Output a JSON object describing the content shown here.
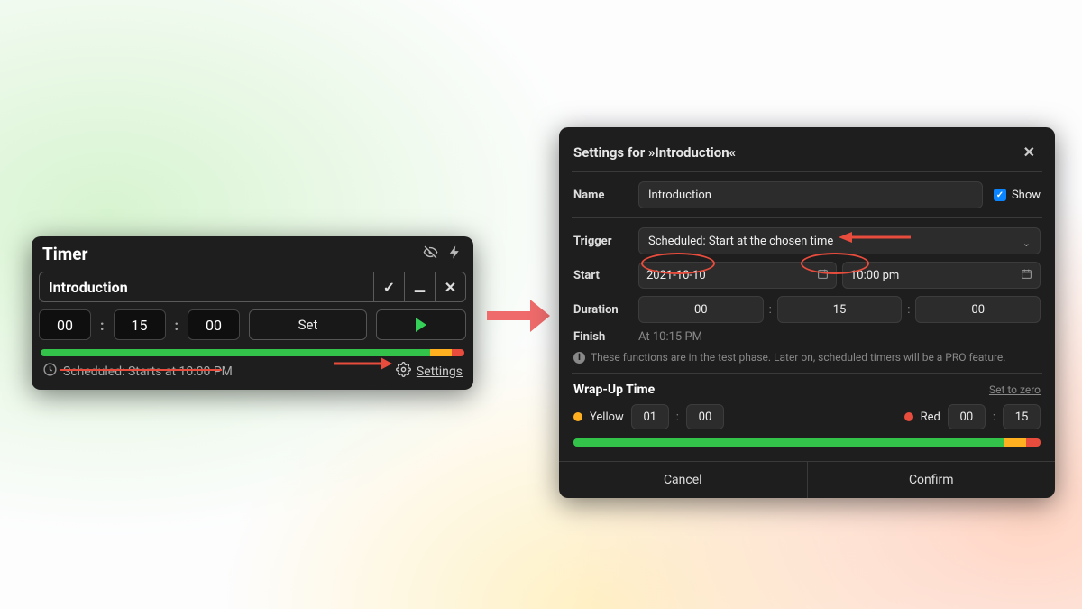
{
  "mini": {
    "title": "Timer",
    "item_label": "Introduction",
    "hh": "00",
    "mm": "15",
    "ss": "00",
    "set_label": "Set",
    "scheduled_text": "Scheduled: Starts at 10:00 PM",
    "settings_label": "Settings"
  },
  "dlg": {
    "title": "Settings for »Introduction«",
    "name_label": "Name",
    "name_value": "Introduction",
    "show_label": "Show",
    "trigger_label": "Trigger",
    "trigger_value": "Scheduled: Start at the chosen time",
    "start_label": "Start",
    "start_date": "2021-10-10",
    "start_time": "10:00 pm",
    "duration_label": "Duration",
    "dur_hh": "00",
    "dur_mm": "15",
    "dur_ss": "00",
    "finish_label": "Finish",
    "finish_value": "At 10:15 PM",
    "info_text": "These functions are in the test phase. Later on, scheduled timers will be a PRO feature.",
    "wrap_title": "Wrap-Up Time",
    "set_to_zero": "Set to zero",
    "yellow_label": "Yellow",
    "yellow_mm": "01",
    "yellow_ss": "00",
    "red_label": "Red",
    "red_mm": "00",
    "red_ss": "15",
    "cancel": "Cancel",
    "confirm": "Confirm"
  },
  "colors": {
    "green": "#33c24a",
    "yellow": "#ffb020",
    "red": "#e74c3c"
  }
}
